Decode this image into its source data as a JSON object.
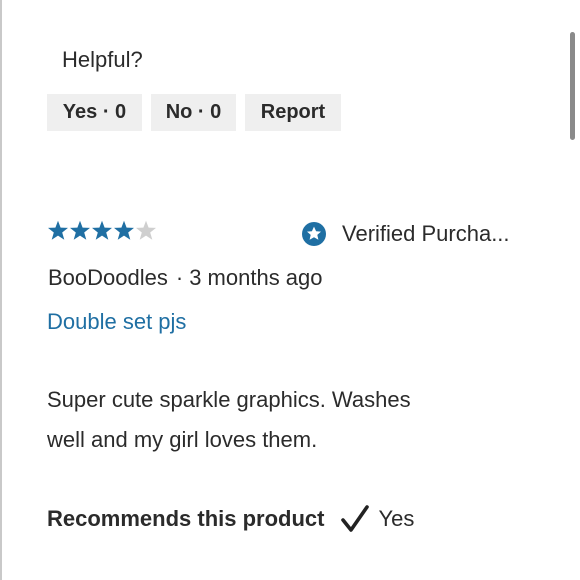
{
  "helpful": {
    "label": "Helpful?",
    "yes_label": "Yes · 0",
    "no_label": "No · 0",
    "report_label": "Report"
  },
  "review": {
    "rating": 4,
    "rating_max": 5,
    "star_color": "#1f6fa3",
    "star_empty_color": "#cfcfcf",
    "verified_label": "Verified Purcha...",
    "author": "BooDoodles",
    "separator": "·",
    "time_ago": "3 months ago",
    "title": "Double set pjs",
    "body_line1": "Super cute sparkle graphics. Washes",
    "body_line2": "well and my girl loves them.",
    "recommends_label": "Recommends this product",
    "recommends_value": "Yes"
  },
  "colors": {
    "accent": "#1f6fa3",
    "button_bg": "#efefef",
    "text": "#2b2b2b"
  },
  "icons": {
    "star": "star-icon",
    "verified": "verified-badge-icon",
    "check": "checkmark-icon"
  }
}
